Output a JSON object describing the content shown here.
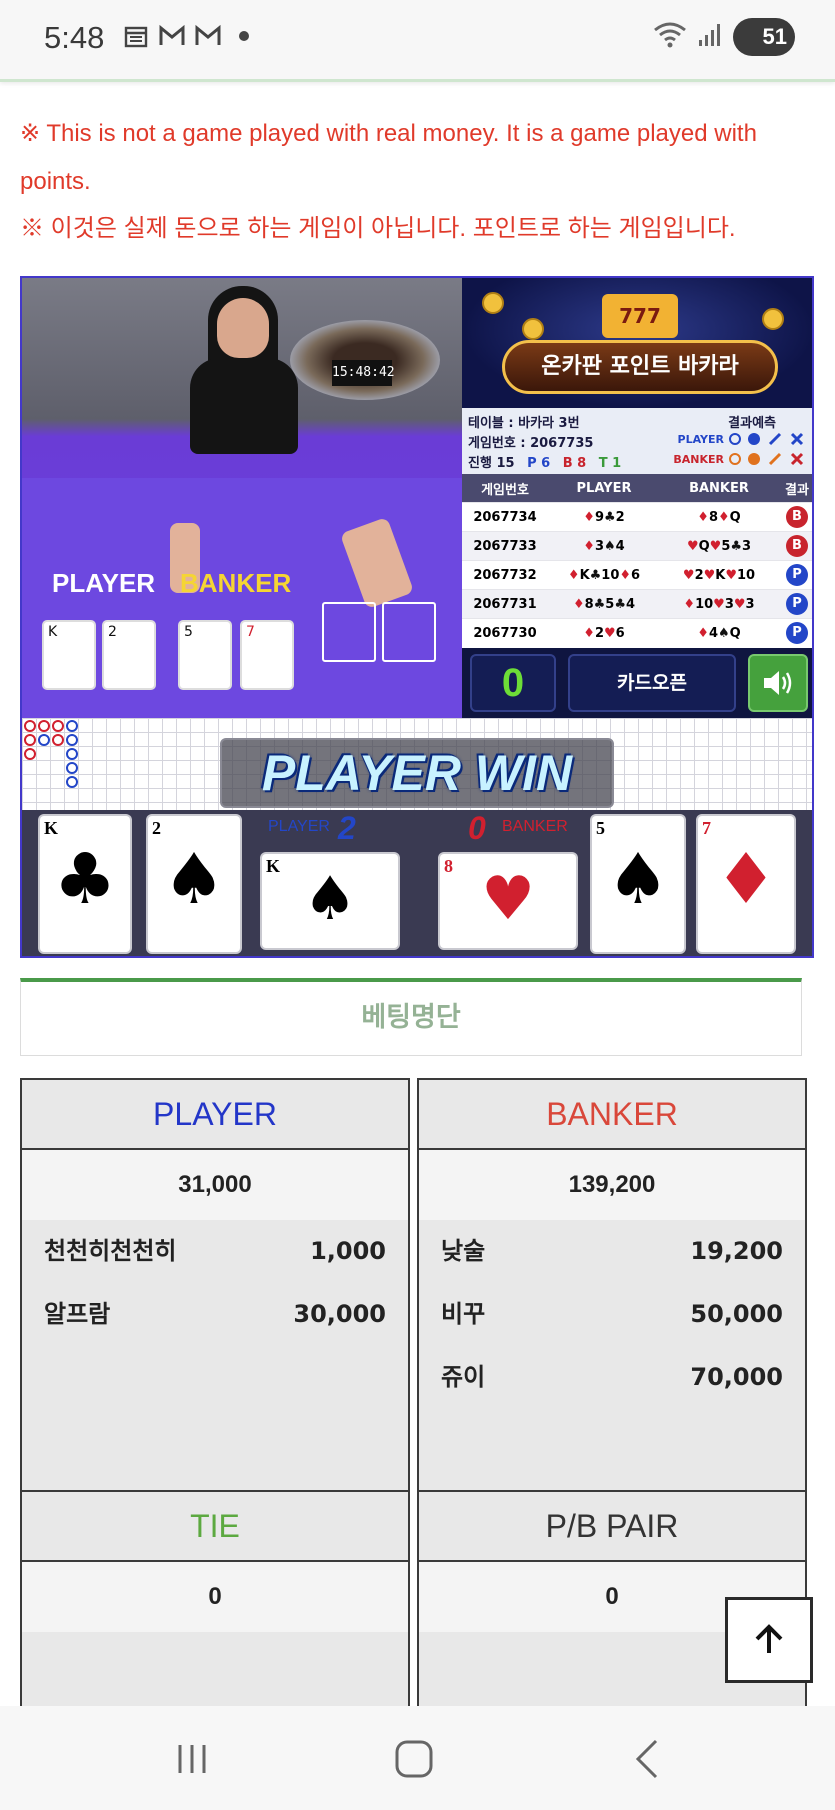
{
  "status_bar": {
    "time": "5:48",
    "battery": "51",
    "icons": [
      "calendar-icon",
      "gmail-icon",
      "gmail-icon",
      "dot-icon",
      "wifi-icon",
      "signal-icon",
      "battery-icon"
    ]
  },
  "notice": {
    "english": "※ This is not a game played with real money. It is a game played with points.",
    "korean": "※ 이것은 실제 돈으로 하는 게임이 아닙니다. 포인트로 하는 게임입니다."
  },
  "video": {
    "clock": "15:48:42",
    "player_label": "PLAYER",
    "banker_label": "BANKER"
  },
  "banner": {
    "title": "온카판 포인트 바카라",
    "slot": "777"
  },
  "game_info": {
    "table": "테이블 : 바카라 3번",
    "game_number": "게임번호 : 2067735",
    "progress_label": "진행 15",
    "p_count": "P 6",
    "b_count": "B 8",
    "t_count": "T 1",
    "prediction_label": "결과예측",
    "player_label": "PLAYER",
    "banker_label": "BANKER"
  },
  "history": {
    "headers": [
      "게임번호",
      "PLAYER",
      "BANKER",
      "결과"
    ],
    "rows": [
      {
        "id": "2067734",
        "player": [
          [
            "♦",
            "9",
            "r"
          ],
          [
            "♣",
            "2",
            "b"
          ]
        ],
        "banker": [
          [
            "♦",
            "8",
            "r"
          ],
          [
            "♦",
            "Q",
            "r"
          ]
        ],
        "result": "B"
      },
      {
        "id": "2067733",
        "player": [
          [
            "♦",
            "3",
            "r"
          ],
          [
            "♠",
            "4",
            "b"
          ]
        ],
        "banker": [
          [
            "♥",
            "Q",
            "r"
          ],
          [
            "♥",
            "5",
            "r"
          ],
          [
            "♣",
            "3",
            "b"
          ]
        ],
        "result": "B"
      },
      {
        "id": "2067732",
        "player": [
          [
            "♦",
            "K",
            "r"
          ],
          [
            "♣",
            "10",
            "b"
          ],
          [
            "♦",
            "6",
            "r"
          ]
        ],
        "banker": [
          [
            "♥",
            "2",
            "r"
          ],
          [
            "♥",
            "K",
            "r"
          ],
          [
            "♥",
            "10",
            "r"
          ]
        ],
        "result": "P"
      },
      {
        "id": "2067731",
        "player": [
          [
            "♦",
            "8",
            "r"
          ],
          [
            "♣",
            "5",
            "b"
          ],
          [
            "♣",
            "4",
            "b"
          ]
        ],
        "banker": [
          [
            "♦",
            "10",
            "r"
          ],
          [
            "♥",
            "3",
            "r"
          ],
          [
            "♥",
            "3",
            "r"
          ]
        ],
        "result": "P"
      },
      {
        "id": "2067730",
        "player": [
          [
            "♦",
            "2",
            "r"
          ],
          [
            "♥",
            "6",
            "r"
          ]
        ],
        "banker": [
          [
            "♦",
            "4",
            "r"
          ],
          [
            "♠",
            "Q",
            "b"
          ]
        ],
        "result": "P"
      }
    ]
  },
  "controls": {
    "counter": "0",
    "open_label": "카드오픈"
  },
  "win_text": "PLAYER WIN",
  "cards": {
    "player_label": "PLAYER",
    "player_score": "2",
    "banker_label": "BANKER",
    "banker_score": "0",
    "player_cards": [
      {
        "rank": "K",
        "suit": "♣",
        "color": "#111111"
      },
      {
        "rank": "2",
        "suit": "♠",
        "color": "#111111"
      },
      {
        "rank": "K",
        "suit": "♠",
        "color": "#111111"
      }
    ],
    "banker_cards": [
      {
        "rank": "8",
        "suit": "♥",
        "color": "#d1202f"
      },
      {
        "rank": "5",
        "suit": "♠",
        "color": "#111111"
      },
      {
        "rank": "7",
        "suit": "♦",
        "color": "#d1202f"
      }
    ]
  },
  "betting": {
    "header": "베팅명단",
    "player": {
      "title": "PLAYER",
      "title_color": "#2336c8",
      "total": "31,000",
      "entries": [
        {
          "name": "천천히천천히",
          "amount": "1,000"
        },
        {
          "name": "알프람",
          "amount": "30,000"
        }
      ]
    },
    "banker": {
      "title": "BANKER",
      "title_color": "#d9473a",
      "total": "139,200",
      "entries": [
        {
          "name": "낮술",
          "amount": "19,200"
        },
        {
          "name": "비꾸",
          "amount": "50,000"
        },
        {
          "name": "쥬이",
          "amount": "70,000"
        }
      ]
    },
    "tie": {
      "title": "TIE",
      "title_color": "#5ca940",
      "total": "0"
    },
    "pair": {
      "title": "P/B PAIR",
      "title_color": "#333333",
      "total": "0"
    }
  }
}
